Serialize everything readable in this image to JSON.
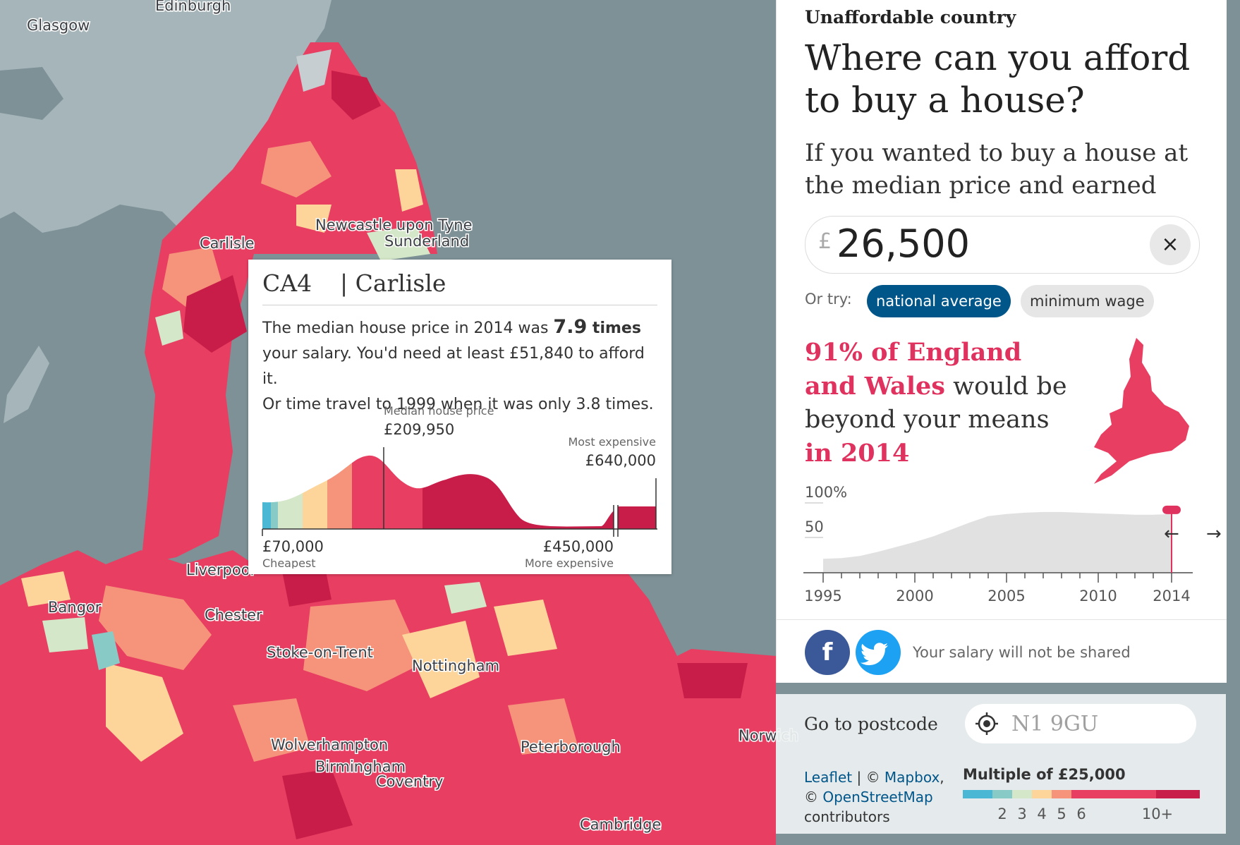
{
  "map": {
    "colors": {
      "sea": "#7d9196",
      "foreign_land": "#a6b5b9",
      "border": "#8a9aa0",
      "band": [
        "#4ab7d4",
        "#88cbc6",
        "#d4e7c8",
        "#fdd49a",
        "#f6937b",
        "#e83e61",
        "#c81d48",
        "#b2e1d7"
      ]
    },
    "labels": [
      "Glasgow",
      "Edinburgh",
      "Newcastle upon Tyne",
      "Sunderland",
      "Carlisle",
      "Liverpool",
      "Bangor",
      "Chester",
      "Stoke-on-Trent",
      "Nottingham",
      "Wolverhampton",
      "Birmingham",
      "Coventry",
      "Peterborough",
      "Norwich",
      "Cambridge"
    ]
  },
  "tooltip": {
    "postcode": "CA4",
    "place": "| Carlisle",
    "line1_a": "The median house price in 2014 was ",
    "multiple": "7.9",
    "line1_b": " times",
    "line2": "your salary. You'd need at least £51,840 to afford it.",
    "line3": "Or time travel to 1999 when it was only 3.8 times.",
    "chart": {
      "median_label": "Median house price",
      "median_value": "£209,950",
      "max_label": "Most expensive",
      "max_value": "£640,000",
      "min_value": "£70,000",
      "min_label": "Cheapest",
      "upper_value": "£450,000",
      "upper_label": "More expensive"
    }
  },
  "panel": {
    "kicker": "Unaffordable country",
    "headline": "Where can you afford to buy a house?",
    "standfirst": "If you wanted to buy a house at the median price and earned",
    "currency": "£",
    "salary": "26,500",
    "clear_icon": "×",
    "or_try": "Or try:",
    "national_average": "national average",
    "minimum_wage": "minimum wage",
    "result": {
      "percent_text": "91% of England and Wales",
      "middle": " would be beyond your means ",
      "in_year": "in 2014"
    },
    "trend": {
      "y_labels": [
        "100%",
        "50"
      ],
      "x_labels": [
        "1995",
        "2000",
        "2005",
        "2010",
        "2014"
      ],
      "years": [
        1995,
        1996,
        1997,
        1998,
        1999,
        2000,
        2001,
        2002,
        2003,
        2004,
        2005,
        2006,
        2007,
        2008,
        2009,
        2010,
        2011,
        2012,
        2013,
        2014
      ],
      "values": [
        20,
        21,
        24,
        30,
        37,
        44,
        52,
        62,
        72,
        81,
        84,
        86,
        87,
        87,
        86,
        85,
        84,
        83,
        83,
        84
      ],
      "selected_year": 2014,
      "left_arrow": "←",
      "right_arrow": "→"
    },
    "share_note": "Your salary will not be shared",
    "facebook_icon": "f",
    "twitter_icon": "🐦"
  },
  "bottom": {
    "goto_label": "Go to postcode",
    "postcode_placeholder": "N1 9GU",
    "attrib_leaflet": "Leaflet",
    "attrib_sep1": " | © ",
    "attrib_mapbox": "Mapbox",
    "attrib_sep2": ", © ",
    "attrib_osm": "OpenStreetMap",
    "attrib_end": " contributors",
    "legend_title": "Multiple of £25,000",
    "legend_ticks": [
      "2",
      "3",
      "4",
      "5",
      "6",
      "10+"
    ]
  }
}
